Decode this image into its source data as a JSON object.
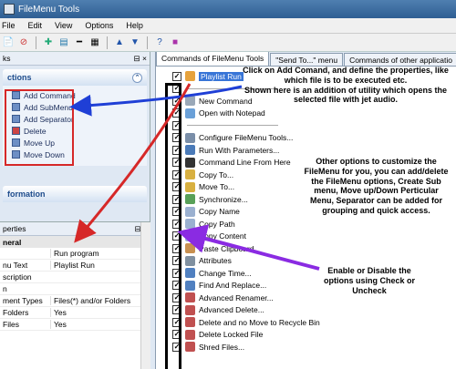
{
  "window": {
    "title": "FileMenu Tools"
  },
  "menu": [
    "File",
    "Edit",
    "View",
    "Options",
    "Help"
  ],
  "toolbar_icons": [
    "new-icon",
    "delete-icon",
    "add-icon",
    "add-submenu-icon",
    "add-separator-icon",
    "properties-icon",
    "move-up-icon",
    "move-down-icon",
    "help-icon",
    "registry-icon"
  ],
  "tasks_pane": {
    "header": "ks",
    "group_title": "ctions",
    "items": [
      "Add Command",
      "Add SubMenu",
      "Add Separator",
      "Delete",
      "Move Up",
      "Move Down"
    ],
    "info_group": "formation"
  },
  "properties_pane": {
    "header": "perties",
    "category": "neral",
    "rows": [
      {
        "k": "",
        "v": "Run program"
      },
      {
        "k": "nu Text",
        "v": "Playlist Run"
      },
      {
        "k": "scription",
        "v": ""
      },
      {
        "k": "n",
        "v": ""
      },
      {
        "k": "ment Types",
        "v": "Files(*) and/or Folders"
      },
      {
        "k": "Folders",
        "v": "Yes"
      },
      {
        "k": "Files",
        "v": "Yes"
      }
    ]
  },
  "tabs": [
    "Commands of FileMenu Tools",
    "\"Send To...\" menu",
    "Commands of other applicatio"
  ],
  "commands": [
    {
      "label": "Playlist Run",
      "selected": true,
      "color": "#e6a23c"
    },
    {
      "label": "",
      "selected": false,
      "color": ""
    },
    {
      "label": "New Command",
      "selected": false,
      "color": "#9aa8b8"
    },
    {
      "label": "Open with Notepad",
      "selected": false,
      "color": "#6aa0d8"
    },
    {
      "label": "",
      "selected": false,
      "color": ""
    },
    {
      "label": "Configure FileMenu Tools...",
      "selected": false,
      "color": "#7a8ea8"
    },
    {
      "label": "Run With Parameters...",
      "selected": false,
      "color": "#4a7ab8"
    },
    {
      "label": "Command Line From Here",
      "selected": false,
      "color": "#333333"
    },
    {
      "label": "Copy To...",
      "selected": false,
      "color": "#d8b040"
    },
    {
      "label": "Move To...",
      "selected": false,
      "color": "#d8b040"
    },
    {
      "label": "Synchronize...",
      "selected": false,
      "color": "#58a058"
    },
    {
      "label": "Copy Name",
      "selected": false,
      "color": "#9ab0d0"
    },
    {
      "label": "Copy Path",
      "selected": false,
      "color": "#9ab0d0"
    },
    {
      "label": "Copy Content",
      "selected": false,
      "color": "#9ab0d0"
    },
    {
      "label": "Paste Clipboard",
      "selected": false,
      "color": "#c89050"
    },
    {
      "label": "Attributes",
      "selected": false,
      "color": "#8090a0"
    },
    {
      "label": "Change Time...",
      "selected": false,
      "color": "#5080c0"
    },
    {
      "label": "Find And Replace...",
      "selected": false,
      "color": "#5080c0"
    },
    {
      "label": "Advanced Renamer...",
      "selected": false,
      "color": "#c05050"
    },
    {
      "label": "Advanced Delete...",
      "selected": false,
      "color": "#c05050"
    },
    {
      "label": "Delete and no Move to Recycle Bin",
      "selected": false,
      "color": "#c05050"
    },
    {
      "label": "Delete Locked File",
      "selected": false,
      "color": "#c05050"
    },
    {
      "label": "Shred Files...",
      "selected": false,
      "color": "#c05050"
    }
  ],
  "annotations": {
    "add_command": "Click on Add Comand, and define the properties, like which file is to be executed etc.\nShown here is an addition of utility which opens the selected file with jet audio.",
    "other_options": "Other options to customize the FileMenu for you, you can add/delete the FileMenu options, Create Sub menu, Move up/Down Perticular Menu, Separator can be added for grouping and quick access.",
    "check": "Enable or Disable the options using Check or Uncheck"
  },
  "colors": {
    "arrow_blue": "#1f3fd6",
    "arrow_red": "#d62828",
    "arrow_purple": "#8a2be2"
  }
}
